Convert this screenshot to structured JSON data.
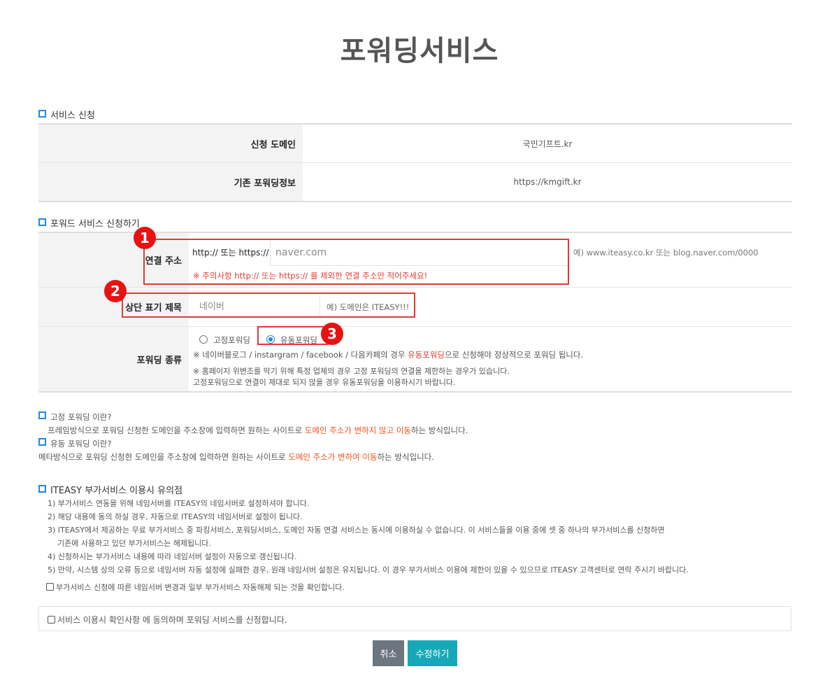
{
  "page_title": "포워딩서비스",
  "section1": {
    "heading": "서비스 신청",
    "rows": [
      {
        "label": "신청 도메인",
        "value": "국민기프트.kr"
      },
      {
        "label": "기존 포워딩정보",
        "value": "https://kmgift.kr"
      }
    ]
  },
  "section2": {
    "heading": "포워드 서비스 신청하기",
    "connect": {
      "label": "연결 주소",
      "prefix": "http:// 또는 https://",
      "placeholder": "naver.com",
      "example": "예) www.iteasy.co.kr 또는 blog.naver.com/0000",
      "warning": "※ 주의사항 http:// 또는 https:// 를 제외한 연결 주소만 적어주세요!"
    },
    "title_row": {
      "label": "상단 표기 제목",
      "placeholder": "네이버",
      "example": "예) 도메인은 ITEASY!!!"
    },
    "type_row": {
      "label": "포워딩 종류",
      "option_fixed": "고정포워딩",
      "option_dynamic": "유동포워딩",
      "selected": "유동포워딩",
      "note1_a": "※ 네이버블로그 / instargram / facebook / 다음카페의 경우 ",
      "note1_b": "유동포워딩",
      "note1_c": "으로 신청해야 정상적으로 포워딩 됩니다.",
      "note2": "※ 홈페이지 위변조를 막기 위해 특정 업체의 경우 고정 포워딩의 연결을 제한하는 경우가 있습니다.",
      "note3": "고정포워딩으로 연결이 제대로 되지 않을 경우 유동포워딩을 이용하시기 바랍니다."
    },
    "badges": [
      "1",
      "2",
      "3"
    ]
  },
  "info": {
    "fixed_title": "고정 포워딩 이란?",
    "fixed_a": "프레임방식으로 포워딩 신청한 도메인을 주소창에 입력하면 원하는 사이트로 ",
    "fixed_b": "도메인 주소가 변하지 않고 이동",
    "fixed_c": "하는 방식입니다.",
    "dynamic_title": "유동 포워딩 이란?",
    "dynamic_a": "메타방식으로 포워딩 신청한 도메인을 주소창에 입력하면 원하는 사이트로 ",
    "dynamic_b": "도메인 주소가 변하여 이동",
    "dynamic_c": "하는 방식입니다."
  },
  "notice": {
    "title": "ITEASY 부가서비스 이용시 유의점",
    "items": [
      "1) 부가서비스 연동을 위해 네임서버를 ITEASY의 네임서버로 설정하셔야 합니다.",
      "2) 해당 내용에 동의 하실 경우, 자동으로 ITEASY의 네임서버로 설정이 됩니다.",
      "3) ITEASY에서 제공하는 무료 부가서비스 중 파킹서비스, 포워딩서비스, 도메인 자동 연결 서비스는 동시에 이용하실 수 없습니다. 이 서비스들을 이용 중에 셋 중 하나의 부가서비스를 신청하면",
      "기존에 사용하고 있던 부가서비스는 해제됩니다.",
      "4) 신청하시는 부가서비스 내용에 따라 네임서버 설정이 자동으로 갱신됩니다.",
      "5) 만약, 시스템 상의 오류 등으로 네임서버 자동 설정에 실패한 경우, 원래 네임서버 설정은 유지됩니다. 이 경우 부가서비스 이용에 제한이 있을 수 있으므로 ITEASY 고객센터로 연락 주시기 바랍니다."
    ],
    "confirm": "부가서비스 신청에 따른 네임서버 변경과 일부 부가서비스 자동해제 되는 것을 확인합니다."
  },
  "agree": "서비스 이용시 확인사항 에 동의하며 포워딩 서비스를 신청합니다.",
  "buttons": {
    "cancel": "취소",
    "submit": "수정하기"
  },
  "colors": {
    "accent_blue": "#1e88e5",
    "highlight_red": "#e53935",
    "submit_teal": "#17a8b8",
    "cancel_gray": "#6b7680"
  }
}
